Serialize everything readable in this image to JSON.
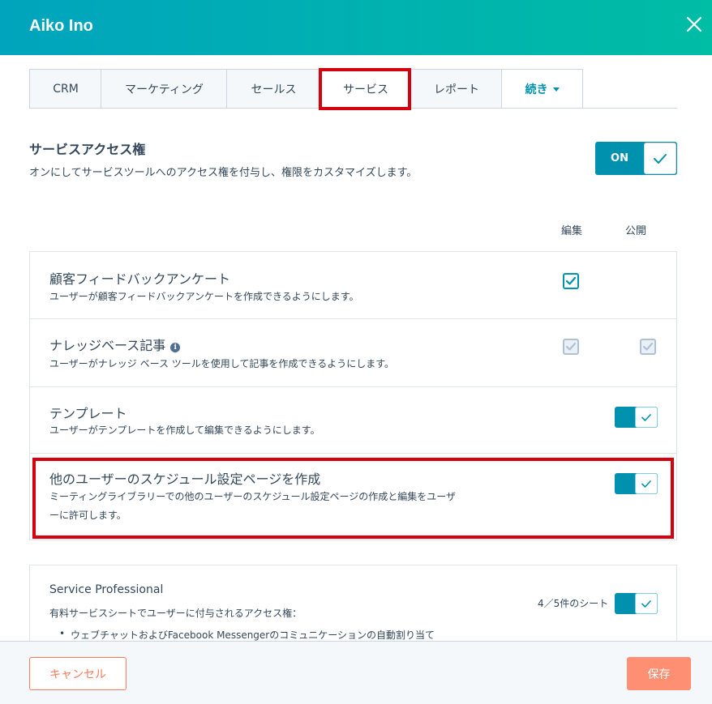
{
  "header": {
    "title": "Aiko Ino",
    "close_icon": "close-icon"
  },
  "tabs": [
    {
      "label": "CRM"
    },
    {
      "label": "マーケティング"
    },
    {
      "label": "セールス"
    },
    {
      "label": "サービス",
      "active": true
    },
    {
      "label": "レポート"
    },
    {
      "label": "続き"
    }
  ],
  "service_access": {
    "title": "サービスアクセス権",
    "description": "オンにしてサービスツールへのアクセス権を付与し、権限をカスタマイズします。",
    "toggle_label": "ON"
  },
  "columns": {
    "edit": "編集",
    "publish": "公開"
  },
  "permissions": [
    {
      "title": "顧客フィードバックアンケート",
      "description": "ユーザーが顧客フィードバックアンケートを作成できるようにします。",
      "control": "checkbox",
      "edit_checked": true
    },
    {
      "title": "ナレッジベース記事",
      "description": "ユーザーがナレッジ ベース ツールを使用して記事を作成できるようにします。",
      "control": "checkbox-disabled",
      "edit_checked": true,
      "publish_checked": true,
      "info_icon": "i"
    },
    {
      "title": "テンプレート",
      "description": "ユーザーがテンプレートを作成して編集できるようにします。",
      "control": "toggle",
      "on": true
    },
    {
      "title": "他のユーザーのスケジュール設定ページを作成",
      "description_line1": "ミーティングライブラリーでの他のユーザーのスケジュール設定ページの作成と編集をユーザ",
      "description_line2": "ーに許可します。",
      "control": "toggle",
      "on": true
    }
  ],
  "service_professional": {
    "title": "Service Professional",
    "description": "有料サービスシートでユーザーに付与されるアクセス権：",
    "bullet": "ウェブチャットおよびFacebook Messengerのコミュニケーションの自動割り当て",
    "seats": "4／5件のシート",
    "on": true
  },
  "footer": {
    "cancel_label": "キャンセル",
    "save_label": "保存"
  },
  "colors": {
    "accent": "#0091ae",
    "header_start": "#00a4bd",
    "header_end": "#00bda5",
    "highlight": "#d6000f",
    "cancel": "#ff7a59",
    "save": "#ff8f73"
  }
}
